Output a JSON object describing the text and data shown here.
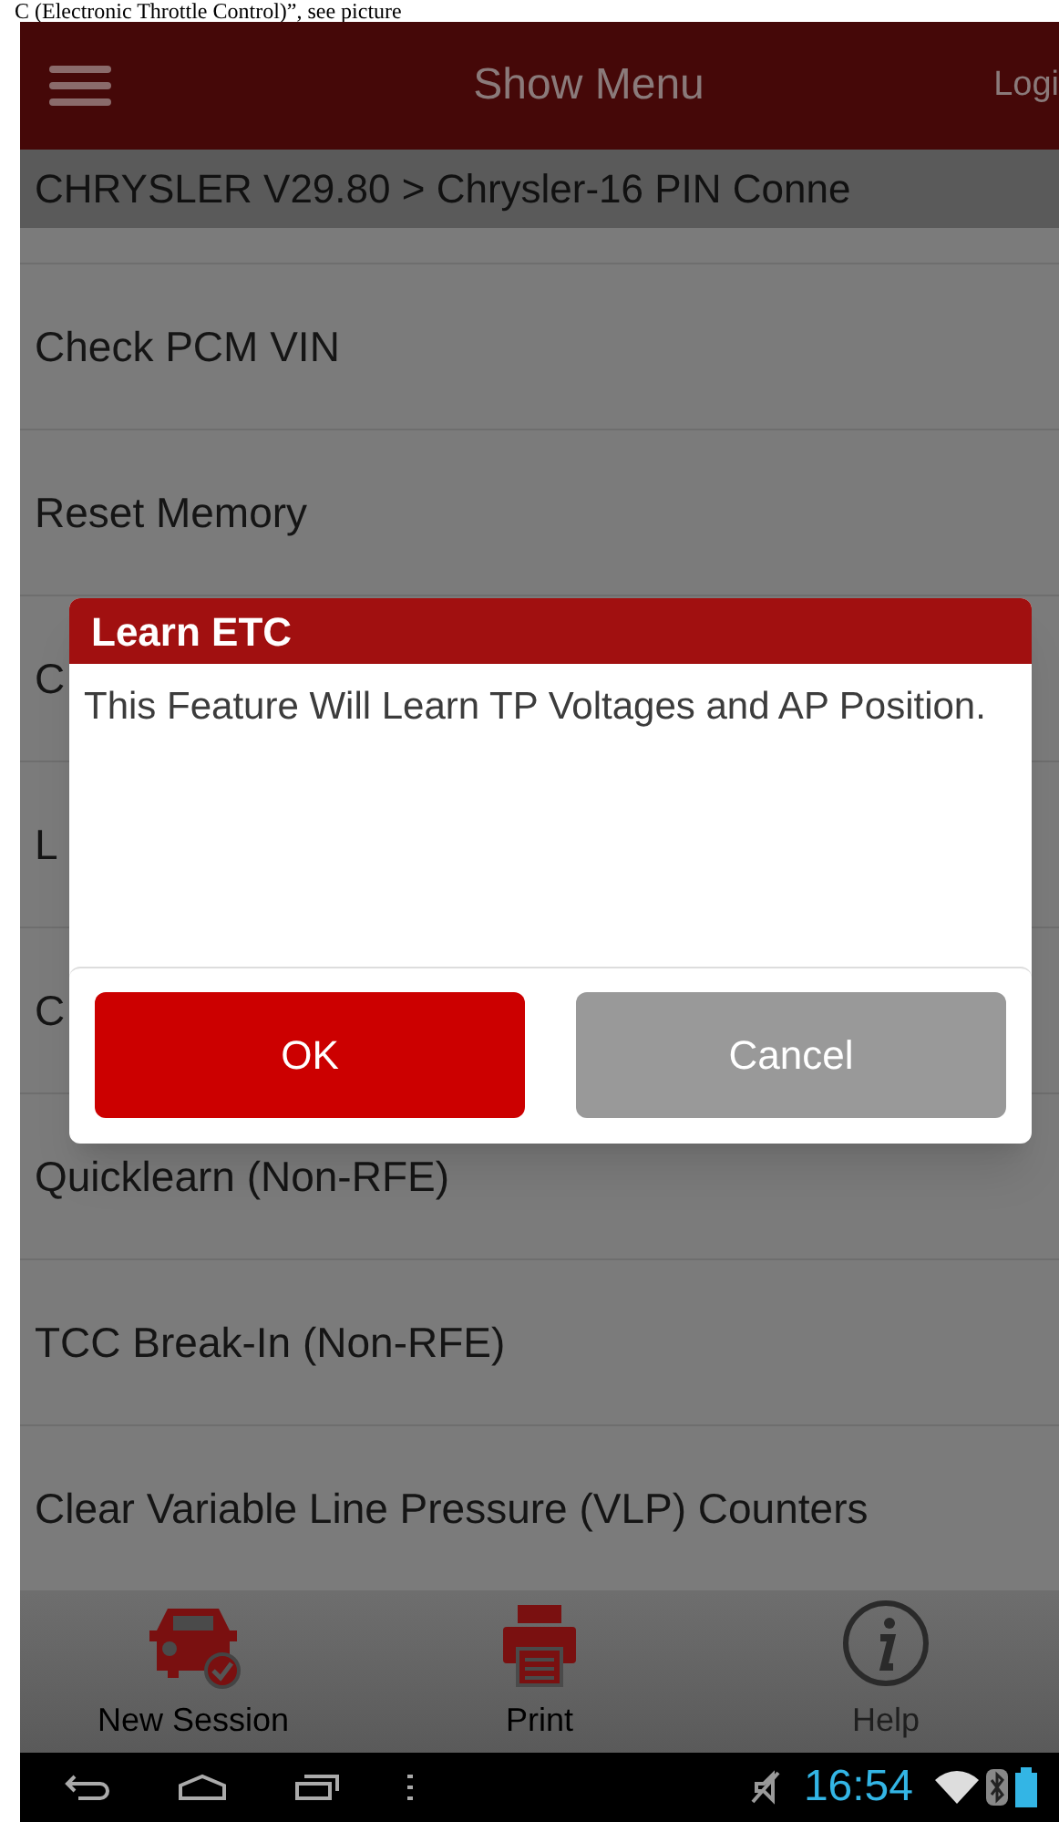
{
  "document_text": "C (Electronic Throttle Control)”, see picture",
  "header": {
    "title": "Show Menu",
    "login": "Logi"
  },
  "breadcrumb": "CHRYSLER V29.80 > Chrysler-16 PIN Conne",
  "menu_items": [
    {
      "label": "Check PCM VIN"
    },
    {
      "label": "Reset Memory"
    },
    {
      "label": "C"
    },
    {
      "label": "L"
    },
    {
      "label": "C"
    },
    {
      "label": "Quicklearn (Non-RFE)"
    },
    {
      "label": "TCC Break-In (Non-RFE)"
    },
    {
      "label": "Clear Variable Line Pressure (VLP) Counters"
    }
  ],
  "dialog": {
    "title": "Learn ETC",
    "message": "This Feature Will Learn TP Voltages and AP Position.",
    "buttons": [
      {
        "label": "OK",
        "kind": "primary"
      },
      {
        "label": "Cancel",
        "kind": "secondary"
      }
    ]
  },
  "bottom_tabs": [
    {
      "label": "New Session",
      "kind": "car",
      "disabled": false
    },
    {
      "label": "Print",
      "kind": "printer",
      "disabled": false
    },
    {
      "label": "Help",
      "kind": "info",
      "disabled": true
    }
  ],
  "status_bar": {
    "time": "16:54"
  }
}
